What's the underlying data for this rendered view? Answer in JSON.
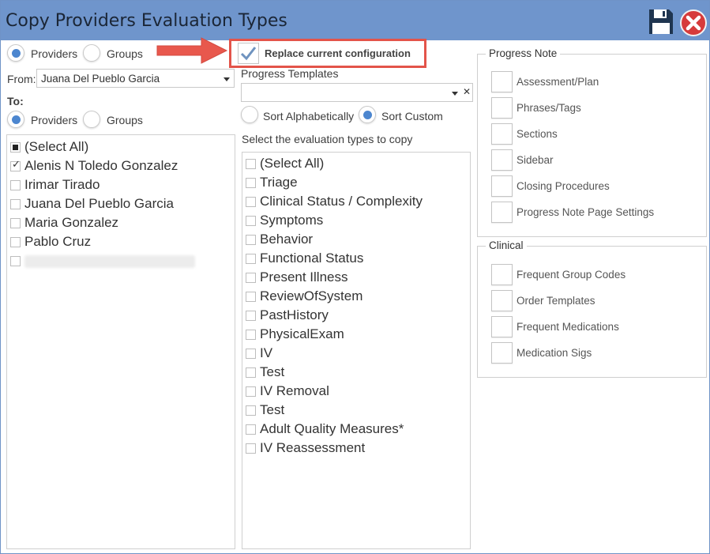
{
  "window": {
    "title": "Copy Providers Evaluation Types"
  },
  "source": {
    "providers_label": "Providers",
    "groups_label": "Groups",
    "from_label": "From:",
    "from_value": "Juana Del Pueblo Garcia"
  },
  "target": {
    "to_label": "To:",
    "providers_label": "Providers",
    "groups_label": "Groups",
    "items": [
      {
        "label": "(Select All)"
      },
      {
        "label": "Alenis N Toledo Gonzalez"
      },
      {
        "label": "Irimar Tirado"
      },
      {
        "label": "Juana Del Pueblo Garcia"
      },
      {
        "label": "Maria Gonzalez"
      },
      {
        "label": "Pablo Cruz"
      },
      {
        "label": ""
      }
    ]
  },
  "middle": {
    "replace_label": "Replace current configuration",
    "templates_label": "Progress Templates",
    "templates_clear": "✕",
    "sort_alpha_label": "Sort Alphabetically",
    "sort_custom_label": "Sort Custom",
    "select_label": "Select the evaluation types to copy",
    "eval_types": [
      {
        "label": "(Select All)"
      },
      {
        "label": "Triage"
      },
      {
        "label": "Clinical Status / Complexity"
      },
      {
        "label": "Symptoms"
      },
      {
        "label": "Behavior"
      },
      {
        "label": "Functional Status"
      },
      {
        "label": "Present Illness"
      },
      {
        "label": "ReviewOfSystem"
      },
      {
        "label": "PastHistory"
      },
      {
        "label": "PhysicalExam"
      },
      {
        "label": "IV"
      },
      {
        "label": "Test"
      },
      {
        "label": "IV Removal"
      },
      {
        "label": "Test"
      },
      {
        "label": "Adult Quality Measures*"
      },
      {
        "label": "IV Reassessment"
      }
    ]
  },
  "progress_note": {
    "title": "Progress Note",
    "items": [
      {
        "label": "Assessment/Plan"
      },
      {
        "label": "Phrases/Tags"
      },
      {
        "label": "Sections"
      },
      {
        "label": "Sidebar"
      },
      {
        "label": "Closing Procedures"
      },
      {
        "label": "Progress Note Page Settings"
      }
    ]
  },
  "clinical": {
    "title": "Clinical",
    "items": [
      {
        "label": "Frequent Group Codes"
      },
      {
        "label": "Order Templates"
      },
      {
        "label": "Frequent Medications"
      },
      {
        "label": "Medication Sigs"
      }
    ]
  }
}
